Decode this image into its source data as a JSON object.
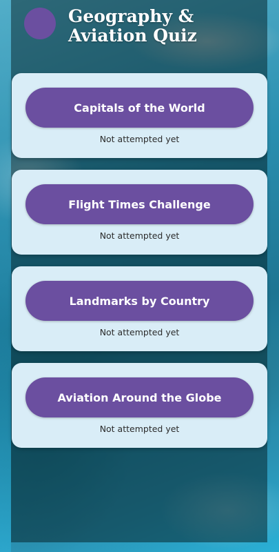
{
  "header": {
    "title": "Geography & Aviation Quiz"
  },
  "quizzes": [
    {
      "label": "Capitals of the World",
      "status": "Not attempted yet"
    },
    {
      "label": "Flight Times Challenge",
      "status": "Not attempted yet"
    },
    {
      "label": "Landmarks by Country",
      "status": "Not attempted yet"
    },
    {
      "label": "Aviation Around the Globe",
      "status": "Not attempted yet"
    }
  ],
  "colors": {
    "accent": "#6b4fa0",
    "card": "#d9edf7"
  }
}
